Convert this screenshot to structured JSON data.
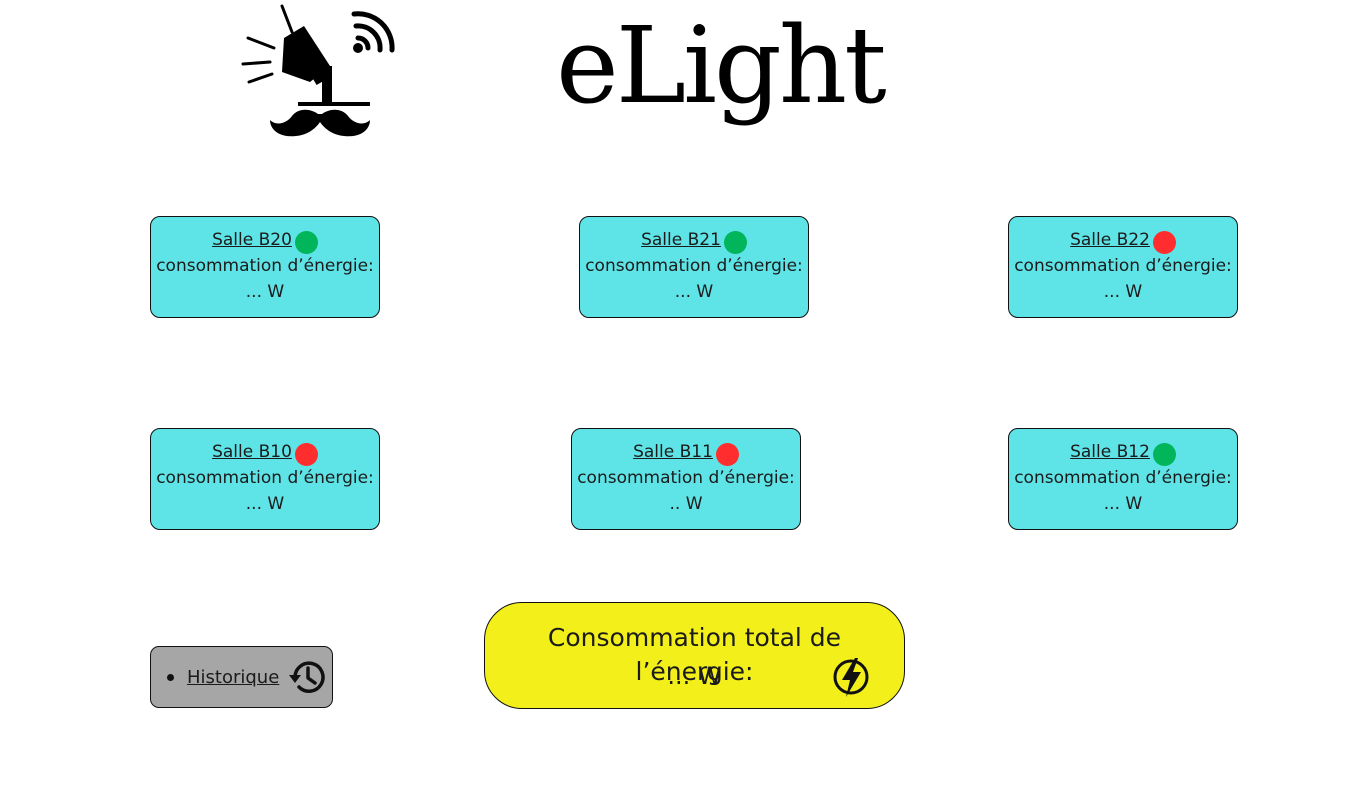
{
  "header": {
    "title": "eLight",
    "logo_icon": "spotlight-wifi-mustache-icon"
  },
  "colors": {
    "card_bg": "#5ee3e6",
    "status_on": "#00b55a",
    "status_off": "#ff2d2d",
    "history_bg": "#a6a6a6",
    "total_bg": "#f2ef1a"
  },
  "rooms": [
    {
      "name": "Salle B20",
      "status": "on",
      "status_color": "#00b55a",
      "label": "consommation d’énergie:",
      "value": "... W"
    },
    {
      "name": "Salle B21",
      "status": "on",
      "status_color": "#00b55a",
      "label": "consommation d’énergie:",
      "value": "... W"
    },
    {
      "name": "Salle B22",
      "status": "off",
      "status_color": "#ff2d2d",
      "label": "consommation d’énergie:",
      "value": "... W"
    },
    {
      "name": "Salle B10",
      "status": "off",
      "status_color": "#ff2d2d",
      "label": "consommation d’énergie:",
      "value": "... W"
    },
    {
      "name": "Salle B11",
      "status": "off",
      "status_color": "#ff2d2d",
      "label": "consommation d’énergie:",
      "value": ".. W"
    },
    {
      "name": "Salle B12",
      "status": "on",
      "status_color": "#00b55a",
      "label": "consommation d’énergie:",
      "value": "... W"
    }
  ],
  "history": {
    "label": "Historique",
    "icon": "history-clock-icon"
  },
  "total": {
    "label": "Consommation total de l’énergie:",
    "value": "... W",
    "icon": "lightning-bolt-icon"
  }
}
